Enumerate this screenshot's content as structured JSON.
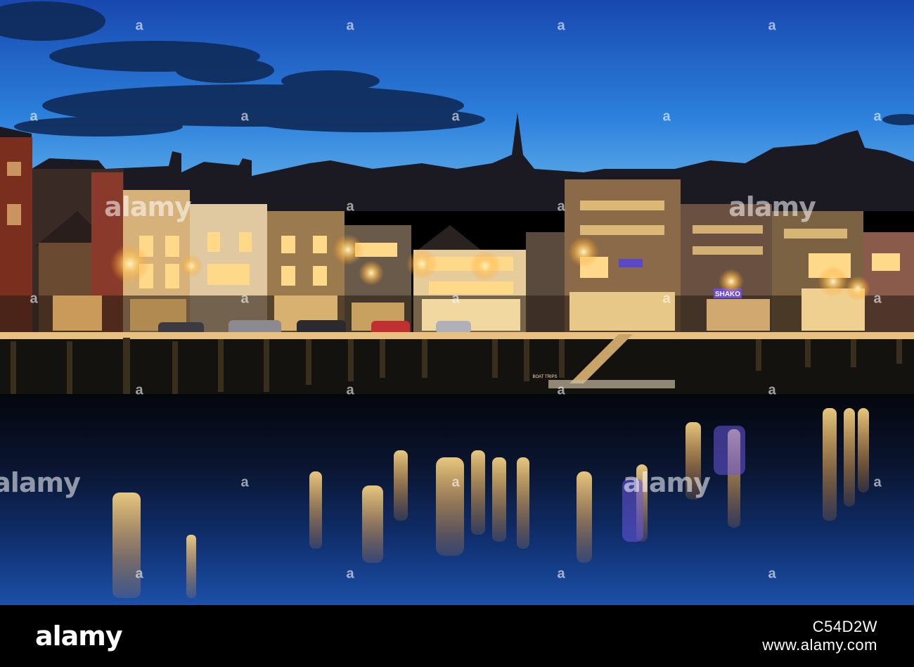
{
  "scene": {
    "sky_top_color": "#1a4fb8",
    "sky_mid_color": "#2f86e0",
    "sky_horizon_color": "#6ab8ee",
    "water_color": "#0a1a40",
    "light_color": "#ffd37a",
    "sign_left": "BOAT TRIPS",
    "sign_shop": "SHAKO"
  },
  "watermark": {
    "text": "alamy",
    "mark": "a"
  },
  "footer": {
    "logo": "alamy",
    "image_code": "C54D2W",
    "url": "www.alamy.com"
  }
}
